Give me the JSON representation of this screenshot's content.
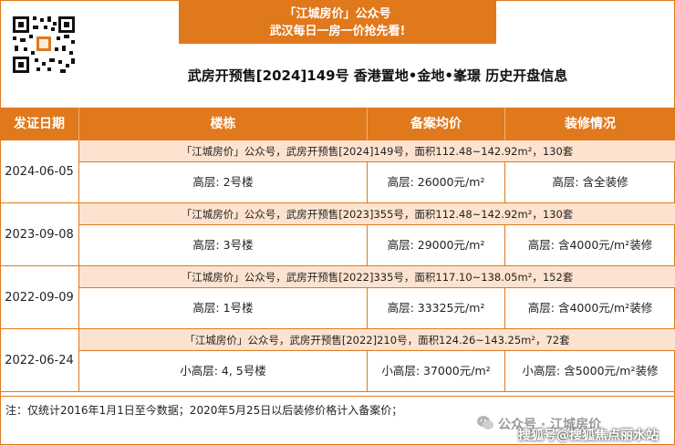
{
  "header": {
    "banner_line1": "「江城房价」公众号",
    "banner_line2": "武汉每日一房一价抢先看!",
    "title": "武房开预售[2024]149号 香港置地•金地•峯璟 历史开盘信息"
  },
  "table": {
    "columns": [
      "发证日期",
      "楼栋",
      "备案均价",
      "装修情况"
    ],
    "groups": [
      {
        "date": "2024-06-05",
        "note": "「江城房价」公众号，武房开预售[2024]149号，面积112.48~142.92m²，130套",
        "building": "高层: 2号楼",
        "price": "高层: 26000元/m²",
        "decoration": "高层: 含全装修"
      },
      {
        "date": "2023-09-08",
        "note": "「江城房价」公众号，武房开预售[2023]355号，面积112.48~142.92m²，130套",
        "building": "高层: 3号楼",
        "price": "高层: 29000元/m²",
        "decoration": "高层: 含4000元/m²装修"
      },
      {
        "date": "2022-09-09",
        "note": "「江城房价」公众号，武房开预售[2022]335号，面积117.10~138.05m²，152套",
        "building": "高层: 1号楼",
        "price": "高层: 33325元/m²",
        "decoration": "高层: 含4000元/m²装修"
      },
      {
        "date": "2022-06-24",
        "note": "「江城房价」公众号，武房开预售[2022]210号，面积124.26~143.25m²，72套",
        "building": "小高层: 4, 5号楼",
        "price": "小高层: 37000元/m²",
        "decoration": "小高层: 含5000元/m²装修"
      }
    ]
  },
  "footer": {
    "note": "注：仅统计2016年1月1日至今数据；2020年5月25日以后装修价格计入备案价；",
    "watermark_1": "公众号 · 江城房价",
    "watermark_2": "搜狐号@搜狐焦点丽水站"
  },
  "colors": {
    "accent": "#e0781c",
    "note_bg": "#fde3cf"
  }
}
